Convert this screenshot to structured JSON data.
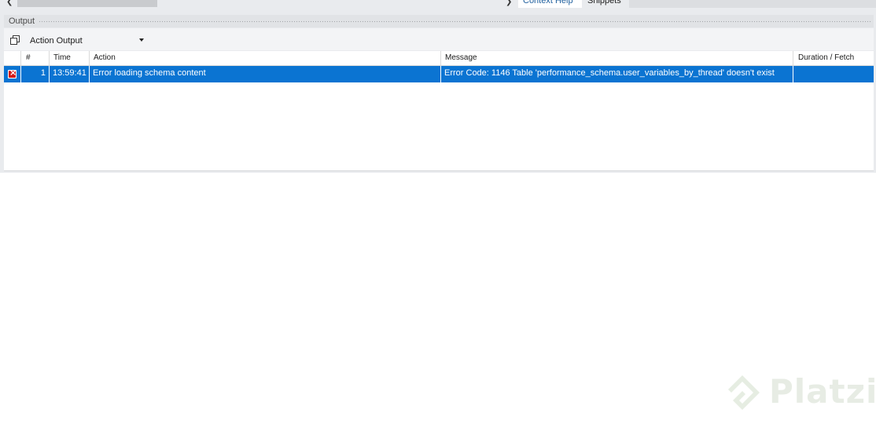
{
  "sidebar_tabs": {
    "active": "Context Help",
    "other": "Snippets"
  },
  "output_panel": {
    "title": "Output",
    "selector": {
      "value": "Action Output"
    },
    "columns": [
      "",
      "#",
      "Time",
      "Action",
      "Message",
      "Duration / Fetch"
    ],
    "rows": [
      {
        "status_icon": "error-icon",
        "number": "1",
        "time": "13:59:41",
        "action": "Error loading schema content",
        "message": "Error Code: 1146 Table 'performance_schema.user_variables_by_thread' doesn't exist",
        "duration": ""
      }
    ]
  },
  "watermark": {
    "text": "Platzi"
  },
  "colors": {
    "selected_row": "#0b74d2",
    "error_red": "#d21a1a",
    "panel_bg": "#e9ebee"
  }
}
